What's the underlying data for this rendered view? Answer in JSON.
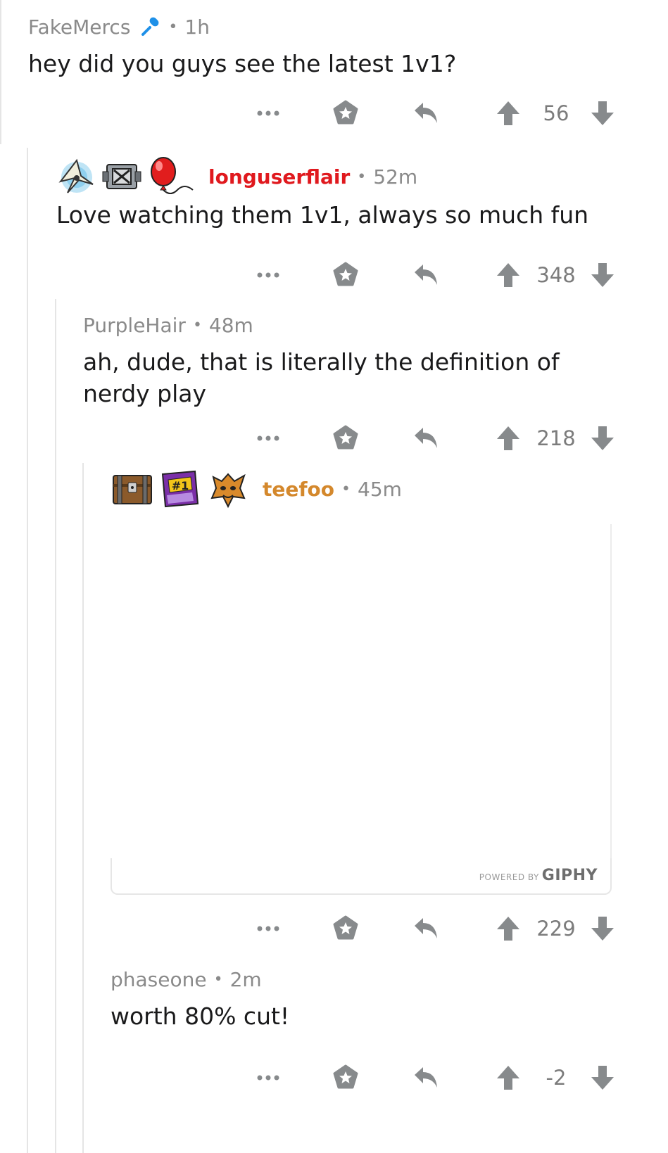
{
  "comments": [
    {
      "username": "FakeMercs",
      "time": "1h",
      "body": "hey did you guys see the latest 1v1?",
      "score": "56",
      "flair_icons": [
        "microphone-icon"
      ]
    },
    {
      "username": "longuserflair",
      "time": "52m",
      "body": "Love watching them 1v1, always so much fun",
      "score": "348",
      "flair_icons": [
        "glider-icon",
        "loot-box-icon",
        "balloon-icon"
      ],
      "username_color": "#e0191e"
    },
    {
      "username": "PurpleHair",
      "time": "48m",
      "body": "ah, dude, that is literally the definition of nerdy play",
      "score": "218"
    },
    {
      "username": "teefoo",
      "time": "45m",
      "body": "",
      "score": "229",
      "flair_icons": [
        "treasure-chest-icon",
        "number-one-icon",
        "dragon-mask-icon"
      ],
      "username_color": "#d4882c",
      "giphy": {
        "powered_by": "POWERED BY",
        "brand": "GIPHY"
      }
    },
    {
      "username": "phaseone",
      "time": "2m",
      "body": "worth 80% cut!",
      "score": "-2"
    }
  ],
  "separator": "•",
  "more_label": "•••",
  "colors": {
    "meta": "#8a8a8a",
    "icon": "#878a8c",
    "thread_line": "#e5e5e5"
  }
}
